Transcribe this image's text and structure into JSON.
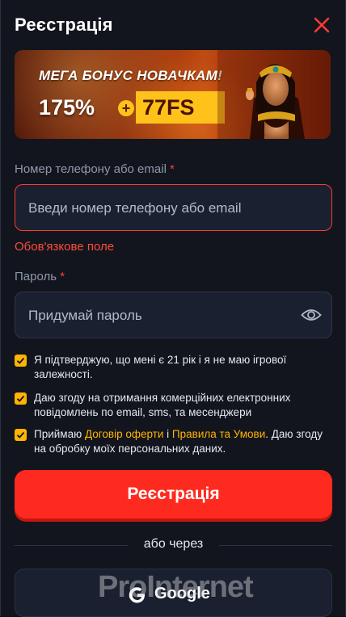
{
  "header": {
    "title": "Реєстрація",
    "close_icon": "close-icon"
  },
  "banner": {
    "headline": "МЕГА БОНУС НОВАЧКАМ!",
    "percent": "175%",
    "plus": "+",
    "freespins": "77FS"
  },
  "phone": {
    "label": "Номер телефону або email",
    "required_mark": "*",
    "placeholder": "Введи номер телефону або email",
    "value": "",
    "error": "Обов'язкове поле"
  },
  "password": {
    "label": "Пароль",
    "required_mark": "*",
    "placeholder": "Придумай пароль",
    "value": "",
    "toggle_icon": "eye-icon"
  },
  "consents": {
    "age": "Я підтверджую, що мені є 21 рік і я не маю ігрової залежності.",
    "marketing": "Даю згоду на отримання комерційних електронних повідомлень по email, sms, та месенджери",
    "terms_prefix": "Приймаю ",
    "terms_link1": "Договір оферти",
    "terms_mid": " і ",
    "terms_link2": "Правила та Умови",
    "terms_suffix": ". Даю згоду на обробку моїх персональних даних."
  },
  "register_button": "Реєстрація",
  "divider_text": "або через",
  "google_button": "Google",
  "watermark": "ProInternet",
  "colors": {
    "accent_red": "#ff2a1f",
    "checkbox_yellow": "#ffb400",
    "error_red": "#ff4a3a",
    "background": "#12151d"
  }
}
